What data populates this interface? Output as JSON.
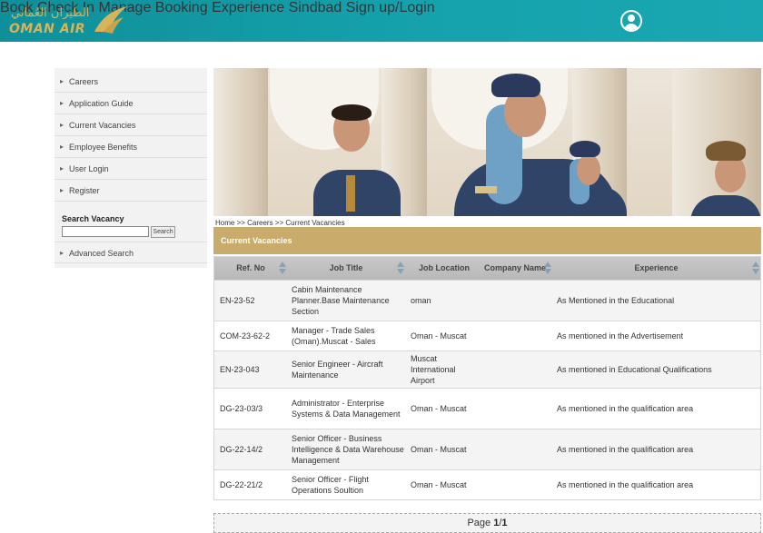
{
  "brand": {
    "arabic_name": "الطيران العُماني",
    "english_name": "OMAN AIR"
  },
  "nav": {
    "items": [
      "Book",
      "Check In",
      "Manage Booking",
      "Experience",
      "Sindbad"
    ],
    "signup_label": "Sign up/Login"
  },
  "sidebar": {
    "items": [
      "Careers",
      "Application Guide",
      "Current Vacancies",
      "Employee Benefits",
      "User Login",
      "Register"
    ],
    "search_label": "Search Vacancy",
    "search_value": "",
    "search_button": "Search",
    "advanced_search": "Advanced Search"
  },
  "breadcrumb": {
    "text": "Home >> Careers >> Current Vacancies"
  },
  "vacancies": {
    "title": "Current Vacancies",
    "columns": [
      "Ref. No",
      "Job Title",
      "Job Location",
      "Company Name",
      "Experience"
    ],
    "rows": [
      {
        "ref": "EN-23-52",
        "title": "Cabin Maintenance Planner.Base Maintenance Section",
        "location": "oman",
        "company": "",
        "experience": "As Mentioned in the Educational"
      },
      {
        "ref": "COM-23-62-2",
        "title": "Manager - Trade Sales (Oman).Muscat - Sales",
        "location": "Oman - Muscat",
        "company": "",
        "experience": "As mentioned in the Advertisement"
      },
      {
        "ref": "EN-23-043",
        "title": "Senior Engineer - Aircraft Maintenance",
        "location": "Muscat International Airport",
        "company": "",
        "experience": "As mentioned in Educational Qualifications"
      },
      {
        "ref": "DG-23-03/3",
        "title": "Administrator - Enterprise Systems & Data Management",
        "location": "Oman - Muscat",
        "company": "",
        "experience": "As mentioned in the qualification area"
      },
      {
        "ref": "DG-22-14/2",
        "title": "Senior Officer - Business Intelligence & Data Warehouse Management",
        "location": "Oman - Muscat",
        "company": "",
        "experience": "As mentioned in the qualification area"
      },
      {
        "ref": "DG-22-21/2",
        "title": "Senior Officer - Flight Operations Soultion",
        "location": "Oman - Muscat",
        "company": "",
        "experience": "As mentioned in the qualification area"
      }
    ]
  },
  "pagination": {
    "label": "Page",
    "current": "1",
    "separator": "/",
    "total": "1"
  },
  "colors": {
    "header_teal": "#15a2ad",
    "gold": "#c9ac6c",
    "logo_gold": "#d8b35a"
  }
}
